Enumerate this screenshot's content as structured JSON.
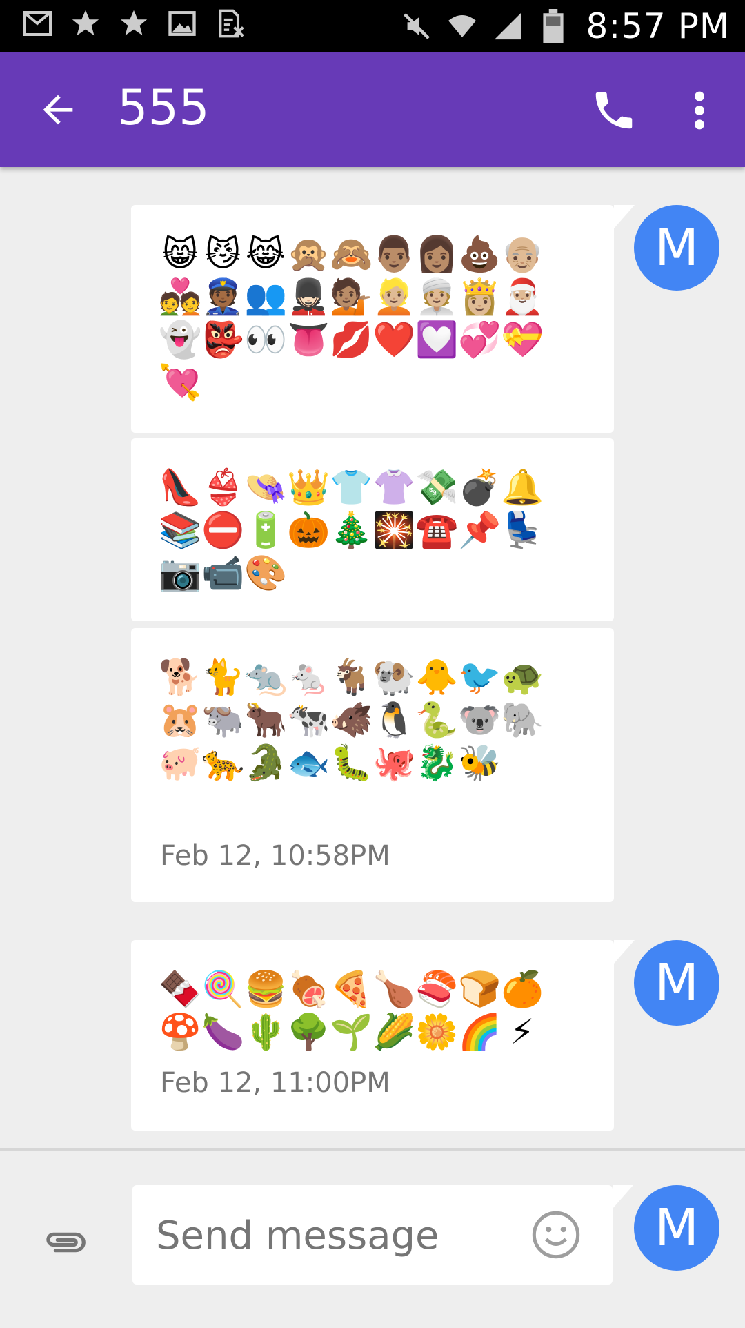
{
  "status_bar": {
    "time": "8:57 PM",
    "left_icons": [
      "gmail-icon",
      "star-icon",
      "star-icon",
      "image-icon",
      "sim-icon"
    ],
    "right_icons": [
      "mute-icon",
      "wifi-icon",
      "signal-icon",
      "battery-icon"
    ]
  },
  "header": {
    "title": "555"
  },
  "messages": [
    {
      "emoji": [
        "😸",
        "😼",
        "😹",
        "🙊",
        "🙈",
        "👨🏽",
        "👩🏽",
        "💩",
        "👴🏼",
        "💑",
        "👮🏾",
        "👥",
        "💂🏻",
        "💁🏽",
        "👱🏼",
        "👳🏼",
        "👸🏼",
        "🎅🏼",
        "👻",
        "👺",
        "👀",
        "👅",
        "💋",
        "❤️",
        "💟",
        "💞",
        "💝",
        "💘"
      ],
      "avatar": "M"
    },
    {
      "emoji": [
        "👠",
        "👙",
        "👒",
        "👑",
        "👕",
        "👚",
        "💸",
        "💣",
        "🔔",
        "📚",
        "⛔",
        "🔋",
        "🎃",
        "🎄",
        "🎇",
        "☎️",
        "📌",
        "💺",
        "📷",
        "📹",
        "🎨"
      ]
    },
    {
      "emoji": [
        "🐕",
        "🐈",
        "🐀",
        "🐁",
        "🐐",
        "🐏",
        "🐥",
        "🐦",
        "🐢",
        "🐹",
        "🐃",
        "🐂",
        "🐄",
        "🐗",
        "🐧",
        "🐍",
        "🐨",
        "🐘",
        "🐖",
        "🐆",
        "🐊",
        "🐟",
        "🐛",
        "🐙",
        "🐉",
        "🐝"
      ],
      "timestamp": "Feb 12, 10:58PM"
    },
    {
      "emoji": [
        "🍫",
        "🍭",
        "🍔",
        "🍖",
        "🍕",
        "🍗",
        "🍣",
        "🍞",
        "🍊",
        "🍄",
        "🍆",
        "🌵",
        "🌳",
        "🌱",
        "🌽",
        "🌼",
        "🌈",
        "⚡"
      ],
      "timestamp": "Feb 12, 11:00PM",
      "avatar": "M"
    }
  ],
  "compose": {
    "placeholder": "Send message",
    "avatar": "M"
  },
  "colors": {
    "app_bar": "#673ab7",
    "avatar": "#4285f4",
    "background": "#eeeeee"
  }
}
